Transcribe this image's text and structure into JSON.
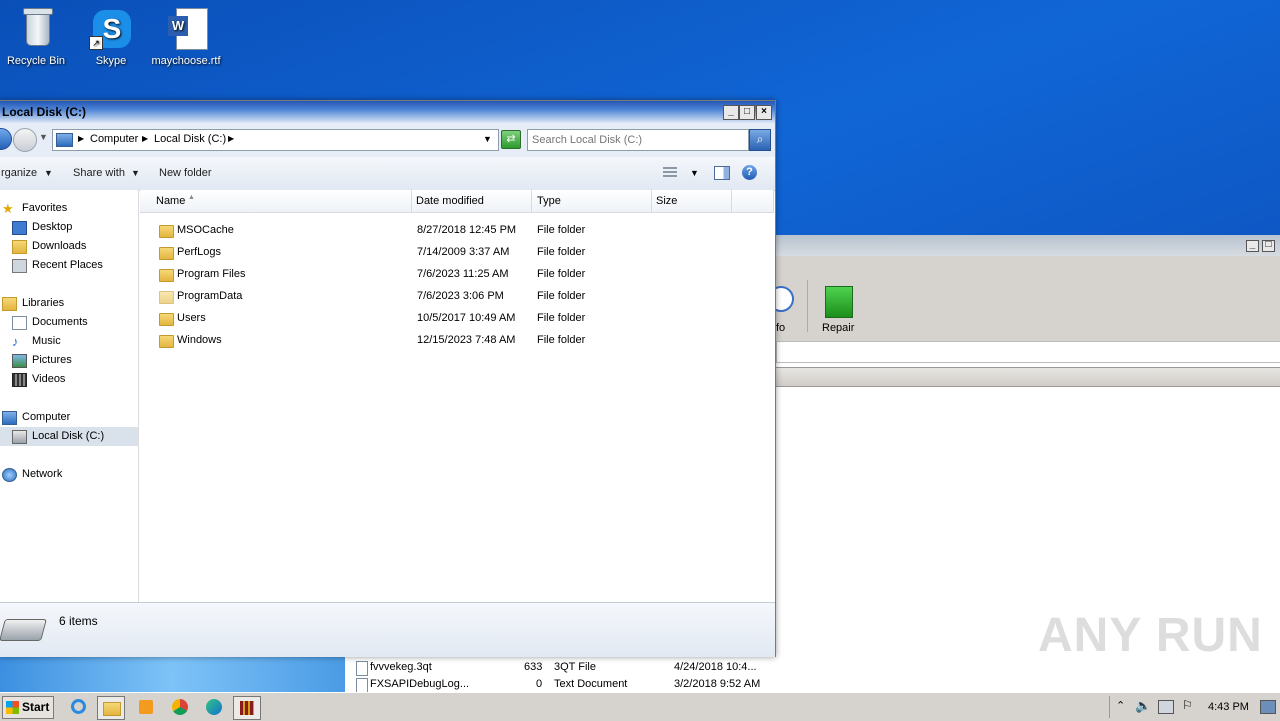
{
  "desktop": {
    "icons": [
      {
        "label": "Recycle Bin",
        "icon": "recycle-bin-icon"
      },
      {
        "label": "Skype",
        "icon": "skype-icon"
      },
      {
        "label": "maychoose.rtf",
        "icon": "word-document-icon"
      }
    ]
  },
  "explorer": {
    "title": "Local Disk (C:)",
    "breadcrumb": [
      "Computer",
      "Local Disk (C:)"
    ],
    "search_placeholder": "Search Local Disk (C:)",
    "commands": {
      "organize": "rganize",
      "share_with": "Share with",
      "new_folder": "New folder"
    },
    "columns": {
      "name": "Name",
      "date": "Date modified",
      "type": "Type",
      "size": "Size"
    },
    "files": [
      {
        "name": "MSOCache",
        "date": "8/27/2018 12:45 PM",
        "type": "File folder",
        "locked": true
      },
      {
        "name": "PerfLogs",
        "date": "7/14/2009 3:37 AM",
        "type": "File folder"
      },
      {
        "name": "Program Files",
        "date": "7/6/2023 11:25 AM",
        "type": "File folder"
      },
      {
        "name": "ProgramData",
        "date": "7/6/2023 3:06 PM",
        "type": "File folder"
      },
      {
        "name": "Users",
        "date": "10/5/2017 10:49 AM",
        "type": "File folder"
      },
      {
        "name": "Windows",
        "date": "12/15/2023 7:48 AM",
        "type": "File folder"
      }
    ],
    "nav": {
      "favorites": "Favorites",
      "desktop": "Desktop",
      "downloads": "Downloads",
      "recent": "Recent Places",
      "libraries": "Libraries",
      "documents": "Documents",
      "music": "Music",
      "pictures": "Pictures",
      "videos": "Videos",
      "computer": "Computer",
      "local_disk": "Local Disk (C:)",
      "network": "Network"
    },
    "status": "6 items"
  },
  "backwindow": {
    "info_label": "fo",
    "repair_label": "Repair",
    "rows": [
      {
        "name": "fvvvekeg.3qt",
        "size": "633",
        "type": "3QT File",
        "date": "4/24/2018 10:4..."
      },
      {
        "name": "FXSAPIDebugLog...",
        "size": "0",
        "type": "Text Document",
        "date": "3/2/2018 9:52 AM"
      }
    ]
  },
  "taskbar": {
    "start": "Start",
    "time": "4:43 PM"
  },
  "watermark": "ANY RUN"
}
